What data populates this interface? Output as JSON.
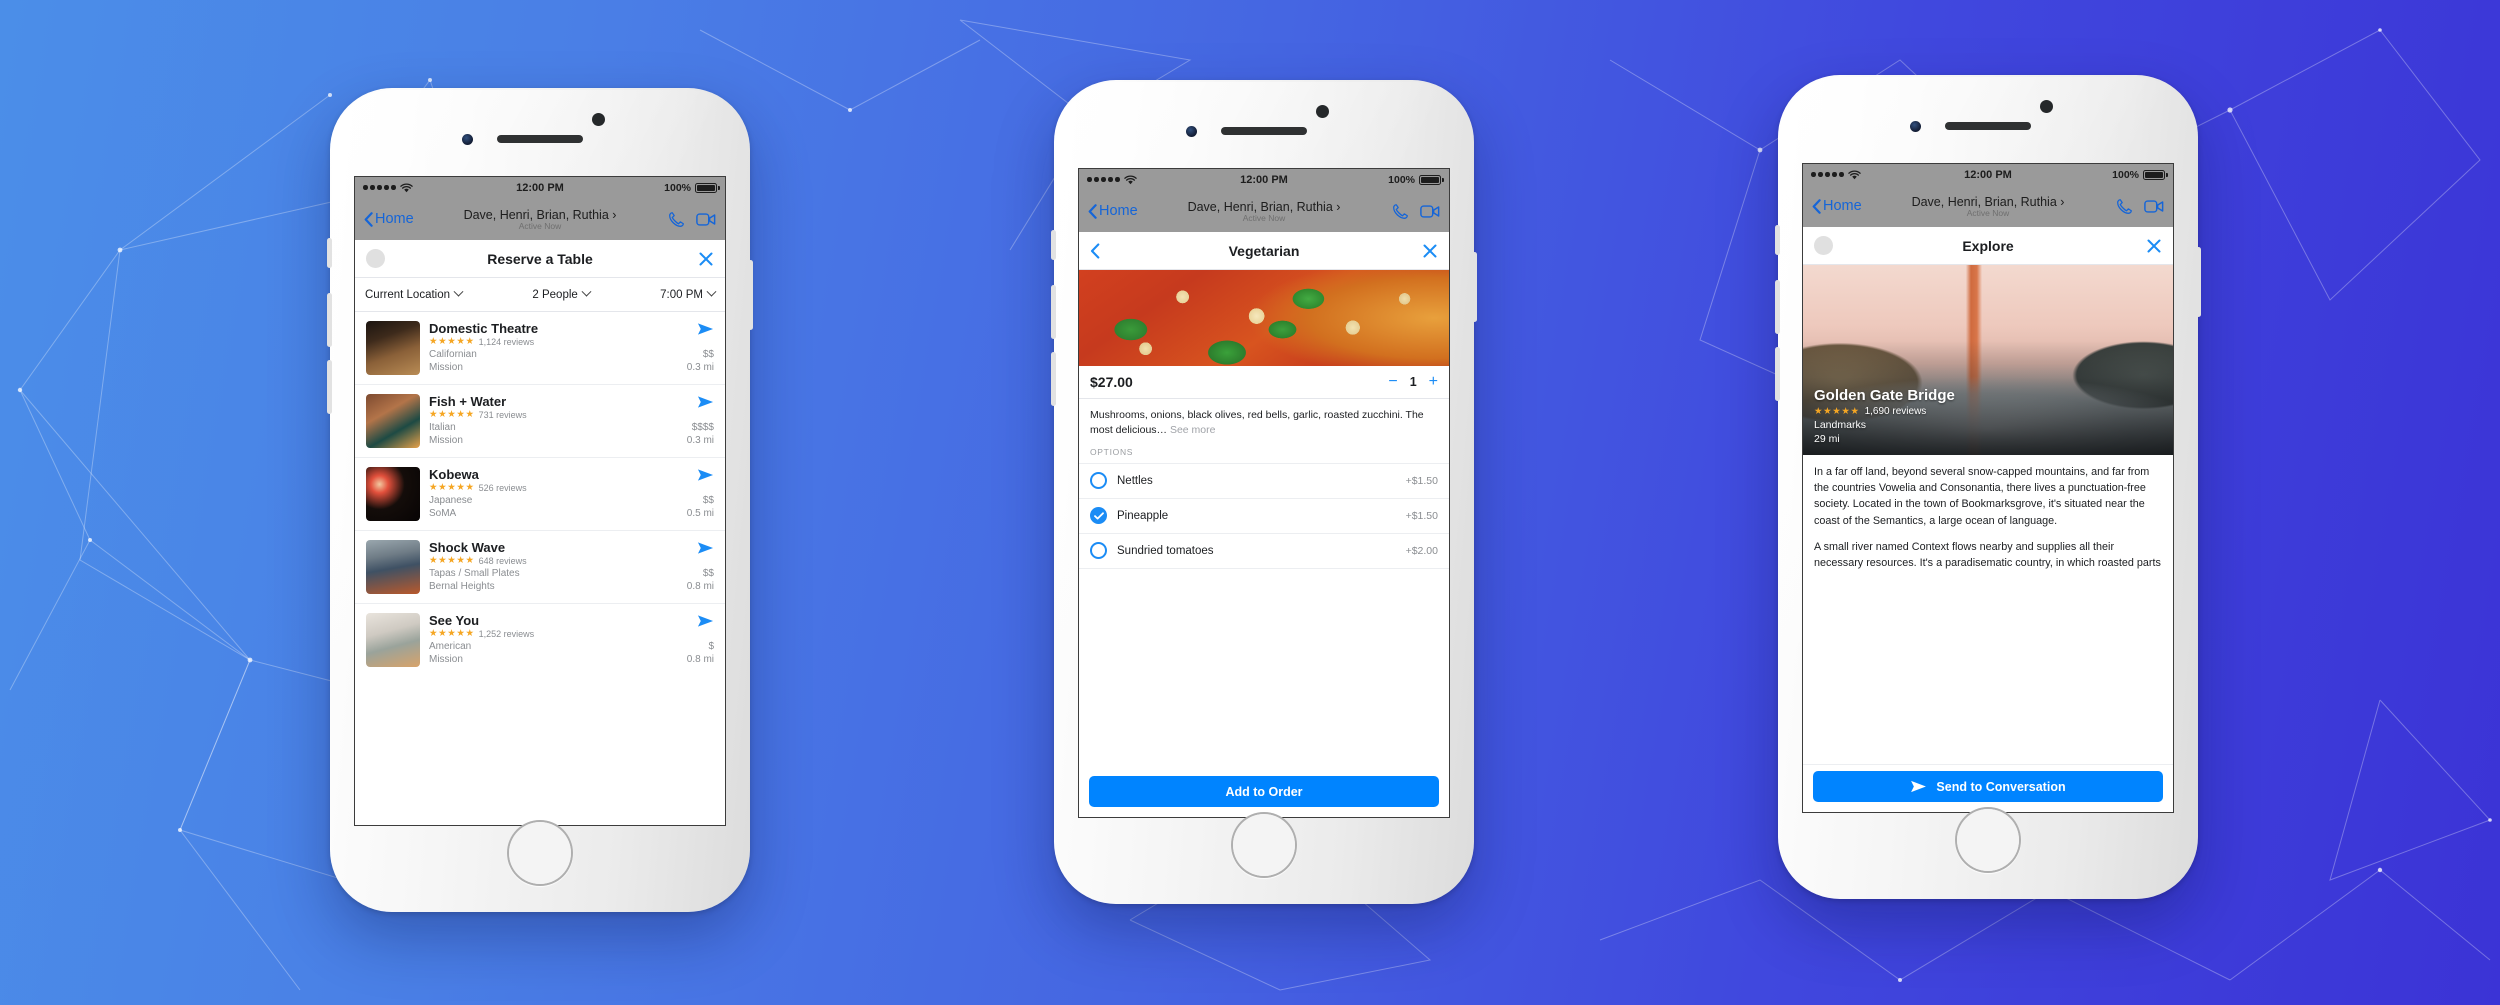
{
  "background": {
    "gradient_from": "#4b8ee8",
    "gradient_to": "#3b33d6",
    "accent": "#0084ff"
  },
  "messenger_chrome": {
    "status_bar": {
      "time": "12:00 PM",
      "battery": "100%",
      "signal_icon": "signal-dots-icon",
      "wifi_icon": "wifi-icon"
    },
    "nav": {
      "back_label": "Home",
      "thread_title": "Dave, Henri, Brian, Ruthia",
      "thread_chevron": "›",
      "presence": "Active Now",
      "call_icon": "phone-icon",
      "video_icon": "video-camera-icon"
    }
  },
  "phones": [
    {
      "id": "reserve-a-table",
      "sheet": {
        "title": "Reserve a Table",
        "left_control": "avatar",
        "close_icon": "close-icon"
      },
      "filters": [
        {
          "label": "Current Location",
          "chevron": "chevron-down-icon"
        },
        {
          "label": "2 People",
          "chevron": "chevron-down-icon"
        },
        {
          "label": "7:00 PM",
          "chevron": "chevron-down-icon"
        }
      ],
      "restaurants": [
        {
          "name": "Domestic Theatre",
          "stars": "★★★★★",
          "reviews": "1,124 reviews",
          "cuisine": "Californian",
          "price": "$$",
          "area": "Mission",
          "distance": "0.3 mi",
          "send_icon": "send-icon"
        },
        {
          "name": "Fish + Water",
          "stars": "★★★★★",
          "reviews": "731 reviews",
          "cuisine": "Italian",
          "price": "$$$$",
          "area": "Mission",
          "distance": "0.3 mi",
          "send_icon": "send-icon"
        },
        {
          "name": "Kobewa",
          "stars": "★★★★★",
          "reviews": "526 reviews",
          "cuisine": "Japanese",
          "price": "$$",
          "area": "SoMA",
          "distance": "0.5 mi",
          "send_icon": "send-icon"
        },
        {
          "name": "Shock Wave",
          "stars": "★★★★★",
          "reviews": "648 reviews",
          "cuisine": "Tapas / Small Plates",
          "price": "$$",
          "area": "Bernal Heights",
          "distance": "0.8 mi",
          "send_icon": "send-icon"
        },
        {
          "name": "See You",
          "stars": "★★★★★",
          "reviews": "1,252 reviews",
          "cuisine": "American",
          "price": "$",
          "area": "Mission",
          "distance": "0.8 mi",
          "send_icon": "send-icon"
        }
      ]
    },
    {
      "id": "vegetarian-item",
      "sheet": {
        "title": "Vegetarian",
        "back_icon": "chevron-left-icon",
        "close_icon": "close-icon"
      },
      "hero_image": "vegetarian-pizza-photo",
      "price": "$27.00",
      "quantity": "1",
      "decrement": "−",
      "increment": "+",
      "description": "Mushrooms, onions, black olives, red bells, garlic, roasted zucchini. The most delicious…",
      "see_more": "See more",
      "options_label": "OPTIONS",
      "options": [
        {
          "name": "Nettles",
          "price": "+$1.50",
          "checked": false
        },
        {
          "name": "Pineapple",
          "price": "+$1.50",
          "checked": true
        },
        {
          "name": "Sundried tomatoes",
          "price": "+$2.00",
          "checked": false
        }
      ],
      "cta": "Add to Order"
    },
    {
      "id": "explore-place",
      "sheet": {
        "title": "Explore",
        "left_control": "avatar",
        "close_icon": "close-icon"
      },
      "photo": "golden-gate-bridge-photo",
      "place": {
        "name": "Golden Gate Bridge",
        "stars": "★★★★★",
        "reviews": "1,690 reviews",
        "category": "Landmarks",
        "distance": "29 mi"
      },
      "paragraphs": [
        "In a far off land, beyond several snow-capped mountains, and far from the countries Vowelia and Consonantia, there lives a punctuation-free society. Located in the town of Bookmarksgrove, it's situated near the coast of the Semantics, a large ocean of language.",
        "A small river named Context flows nearby and supplies all their necessary resources. It's a paradisematic country, in which roasted parts"
      ],
      "cta": "Send to Conversation",
      "cta_icon": "send-icon"
    }
  ]
}
